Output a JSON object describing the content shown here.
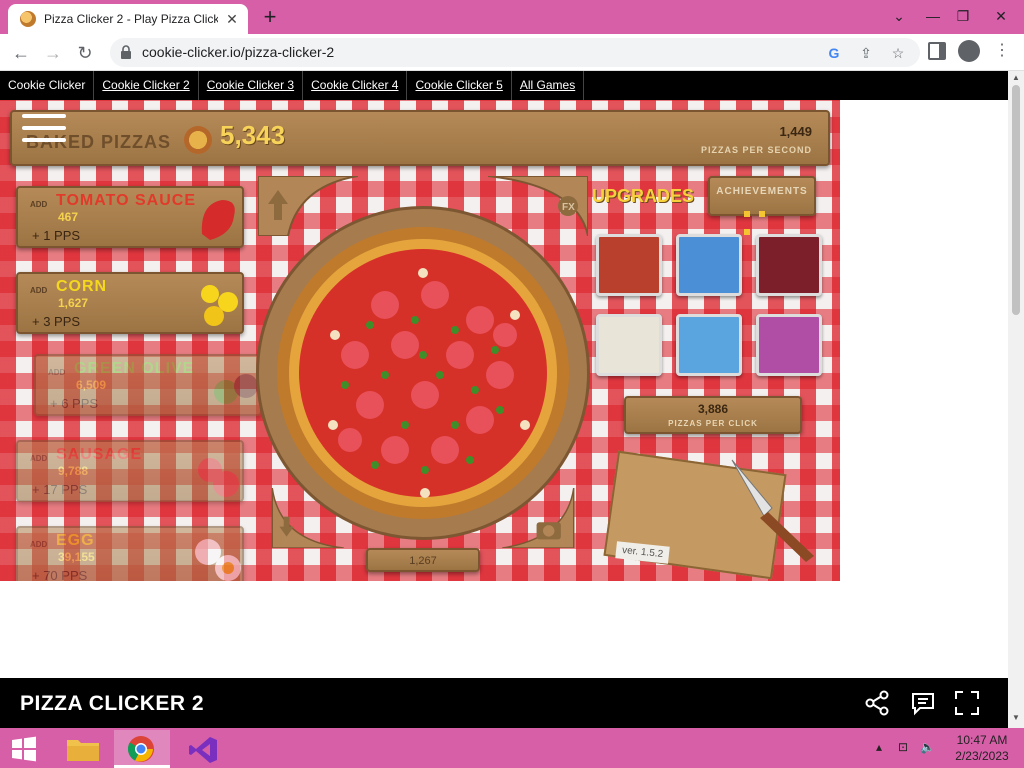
{
  "browser": {
    "tab_title": "Pizza Clicker 2 - Play Pizza Clicke",
    "url": "cookie-clicker.io/pizza-clicker-2"
  },
  "site_nav": {
    "items": [
      "Cookie Clicker",
      "Cookie Clicker 2",
      "Cookie Clicker 3",
      "Cookie Clicker 4",
      "Cookie Clicker 5",
      "All Games"
    ]
  },
  "game": {
    "baked_label": "BAKED PIZZAS",
    "baked_count": "5,343",
    "pps_value": "1,449",
    "pps_label": "PIZZAS PER SECOND",
    "ingredients": [
      {
        "add": "ADD",
        "name": "TOMATO SAUCE",
        "cost": "467",
        "pps": "+ 1 PPS",
        "color": "#e23a2a"
      },
      {
        "add": "ADD",
        "name": "CORN",
        "cost": "1,627",
        "pps": "+ 3 PPS",
        "color": "#f4d81e"
      },
      {
        "add": "ADD",
        "name": "GREEN OLIVE",
        "cost": "6,509",
        "pps": "+ 6 PPS",
        "color": "#7fbf3a"
      },
      {
        "add": "ADD",
        "name": "SAUSAGE",
        "cost": "9,788",
        "pps": "+ 17 PPS",
        "color": "#e23a2a"
      },
      {
        "add": "ADD",
        "name": "EGG",
        "cost": "39,155",
        "pps": "+ 70 PPS",
        "color": "#f4d81e"
      }
    ],
    "upgrades_title": "UPGRADES",
    "achievements_label": "ACHIEVEMENTS",
    "fx_label": "FX",
    "ppc_value": "3,886",
    "ppc_label": "PIZZAS PER CLICK",
    "bottom_count": "1,267",
    "version": "ver. 1.5.2",
    "upgrade_colors": [
      "#b8402c",
      "#4b8fd6",
      "#7d1f2a",
      "#e8e4d8",
      "#5aa5e0",
      "#b04ea6"
    ]
  },
  "footer": {
    "title": "PIZZA CLICKER 2"
  },
  "taskbar": {
    "time": "10:47 AM",
    "date": "2/23/2023"
  }
}
